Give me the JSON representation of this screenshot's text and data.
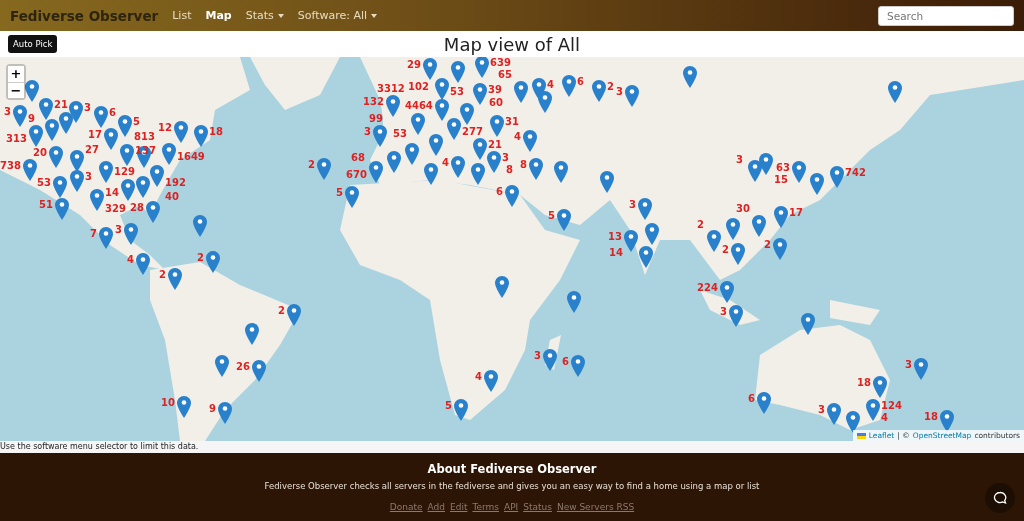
{
  "navbar": {
    "brand": "Fediverse Observer",
    "items": [
      {
        "label": "List",
        "kind": "link",
        "selected": false
      },
      {
        "label": "Map",
        "kind": "link",
        "selected": true
      },
      {
        "label": "Stats",
        "kind": "dropdown",
        "selected": false
      },
      {
        "label": "Software:  All",
        "kind": "dropdown",
        "selected": false
      }
    ],
    "search": {
      "placeholder": "Search"
    }
  },
  "toolbar": {
    "button": "Auto Pick",
    "title": "Map view of All"
  },
  "map": {
    "zoom_in": "+",
    "zoom_out": "−",
    "markers": [
      {
        "kind": "pin"
      },
      {
        "kind": "counted",
        "count": "21"
      },
      {
        "kind": "counted",
        "count": "3"
      },
      {
        "kind": "counted",
        "count": "6"
      },
      {
        "kind": "counted",
        "count": "5"
      },
      {
        "kind": "counted",
        "count": "3"
      },
      {
        "kind": "counted",
        "count": "313"
      },
      {
        "kind": "counted",
        "count": "9"
      },
      {
        "kind": "pin"
      },
      {
        "kind": "counted",
        "count": "17"
      },
      {
        "kind": "counted",
        "count": "12"
      },
      {
        "kind": "counted",
        "count": "18"
      },
      {
        "kind": "counted",
        "count": "20"
      },
      {
        "kind": "counted",
        "count": "27"
      },
      {
        "kind": "counted",
        "count": "813"
      },
      {
        "kind": "counted",
        "count": "137"
      },
      {
        "kind": "counted",
        "count": "129"
      },
      {
        "kind": "counted",
        "count": "1649"
      },
      {
        "kind": "counted",
        "count": "738"
      },
      {
        "kind": "counted",
        "count": "53"
      },
      {
        "kind": "counted",
        "count": "51"
      },
      {
        "kind": "counted",
        "count": "3"
      },
      {
        "kind": "counted",
        "count": "14"
      },
      {
        "kind": "counted",
        "count": "192"
      },
      {
        "kind": "counted",
        "count": "329"
      },
      {
        "kind": "counted",
        "count": "40"
      },
      {
        "kind": "counted",
        "count": "28"
      },
      {
        "kind": "pin"
      },
      {
        "kind": "counted",
        "count": "7"
      },
      {
        "kind": "counted",
        "count": "3"
      },
      {
        "kind": "counted",
        "count": "4"
      },
      {
        "kind": "counted",
        "count": "2"
      },
      {
        "kind": "counted",
        "count": "2"
      },
      {
        "kind": "counted",
        "count": "2"
      },
      {
        "kind": "counted",
        "count": "2"
      },
      {
        "kind": "pin"
      },
      {
        "kind": "pin"
      },
      {
        "kind": "counted",
        "count": "26"
      },
      {
        "kind": "counted",
        "count": "10"
      },
      {
        "kind": "counted",
        "count": "9"
      },
      {
        "kind": "counted",
        "count": "29"
      },
      {
        "kind": "counted",
        "count": "102"
      },
      {
        "kind": "counted",
        "count": "639"
      },
      {
        "kind": "counted",
        "count": "53"
      },
      {
        "kind": "counted",
        "count": "39"
      },
      {
        "kind": "counted",
        "count": "132"
      },
      {
        "kind": "counted",
        "count": "4464"
      },
      {
        "kind": "counted",
        "count": "60"
      },
      {
        "kind": "counted",
        "count": "3"
      },
      {
        "kind": "counted",
        "count": "3312"
      },
      {
        "kind": "counted",
        "count": "277"
      },
      {
        "kind": "counted",
        "count": "31"
      },
      {
        "kind": "counted",
        "count": "53"
      },
      {
        "kind": "counted",
        "count": "4"
      },
      {
        "kind": "counted",
        "count": "21"
      },
      {
        "kind": "counted",
        "count": "3"
      },
      {
        "kind": "counted",
        "count": "99"
      },
      {
        "kind": "counted",
        "count": "68"
      },
      {
        "kind": "counted",
        "count": "670"
      },
      {
        "kind": "counted",
        "count": "4"
      },
      {
        "kind": "counted",
        "count": "8"
      },
      {
        "kind": "pin"
      },
      {
        "kind": "counted",
        "count": "8"
      },
      {
        "kind": "pin"
      },
      {
        "kind": "pin"
      },
      {
        "kind": "counted",
        "count": "5"
      },
      {
        "kind": "counted",
        "count": "6"
      },
      {
        "kind": "counted",
        "count": "5"
      },
      {
        "kind": "counted",
        "count": "65"
      },
      {
        "kind": "counted",
        "count": "4"
      },
      {
        "kind": "pin"
      },
      {
        "kind": "counted",
        "count": "6"
      },
      {
        "kind": "counted",
        "count": "2"
      },
      {
        "kind": "counted",
        "count": "3"
      },
      {
        "kind": "counted",
        "count": "3"
      },
      {
        "kind": "pin"
      },
      {
        "kind": "counted",
        "count": "13"
      },
      {
        "kind": "pin"
      },
      {
        "kind": "pin"
      },
      {
        "kind": "counted",
        "count": "3"
      },
      {
        "kind": "pin"
      },
      {
        "kind": "counted",
        "count": "63"
      },
      {
        "kind": "counted",
        "count": "15"
      },
      {
        "kind": "counted",
        "count": "742"
      },
      {
        "kind": "counted",
        "count": "14"
      },
      {
        "kind": "counted",
        "count": "17"
      },
      {
        "kind": "counted",
        "count": "30"
      },
      {
        "kind": "counted",
        "count": "2"
      },
      {
        "kind": "pin"
      },
      {
        "kind": "counted",
        "count": "2"
      },
      {
        "kind": "counted",
        "count": "2"
      },
      {
        "kind": "counted",
        "count": "224"
      },
      {
        "kind": "counted",
        "count": "3"
      },
      {
        "kind": "pin"
      },
      {
        "kind": "pin"
      },
      {
        "kind": "pin"
      },
      {
        "kind": "counted",
        "count": "3"
      },
      {
        "kind": "counted",
        "count": "6"
      },
      {
        "kind": "counted",
        "count": "4"
      },
      {
        "kind": "counted",
        "count": "5"
      },
      {
        "kind": "counted",
        "count": "3"
      },
      {
        "kind": "counted",
        "count": "18"
      },
      {
        "kind": "counted",
        "count": "6"
      },
      {
        "kind": "counted",
        "count": "3"
      },
      {
        "kind": "counted",
        "count": "124"
      },
      {
        "kind": "counted",
        "count": "4"
      },
      {
        "kind": "counted",
        "count": "18"
      }
    ],
    "attribution": {
      "leaflet": "Leaflet",
      "separator": "| ©",
      "osm": "OpenStreetMap",
      "suffix": "contributors"
    }
  },
  "caption": "Use the software menu selector to limit this data.",
  "footer": {
    "heading": "About Fediverse Observer",
    "text": "Fediverse Observer checks all servers in the fediverse and gives you an easy way to find a home using a map or list",
    "links": [
      "Donate",
      "Add",
      "Edit",
      "Terms",
      "API",
      "Status",
      "New Servers RSS"
    ]
  }
}
